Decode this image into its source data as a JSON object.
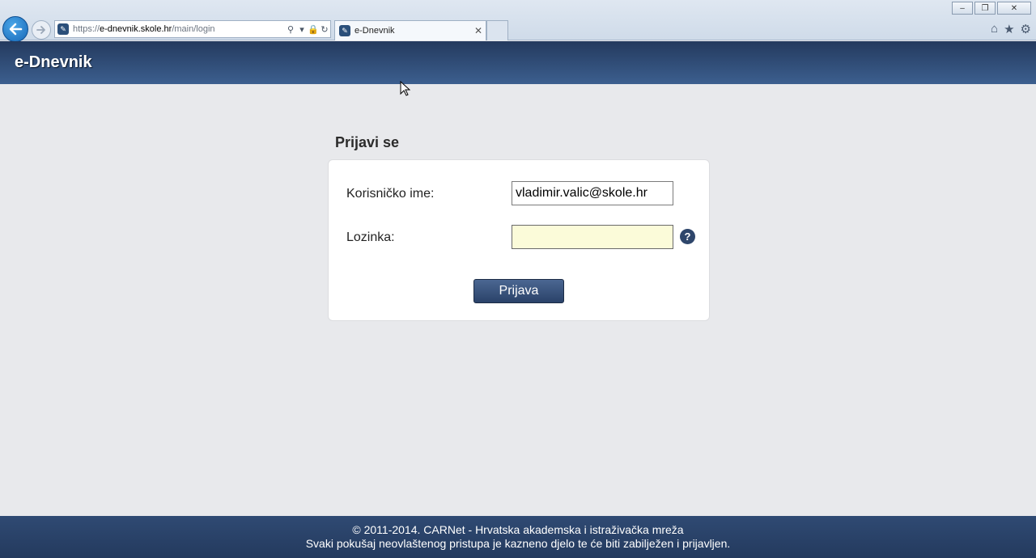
{
  "browser": {
    "address": {
      "proto": "https://",
      "host": "e-dnevnik.skole.hr",
      "path": "/main/login"
    },
    "tab_title": "e-Dnevnik",
    "window_buttons": [
      "‒",
      "❐",
      "✕"
    ]
  },
  "app": {
    "title": "e-Dnevnik"
  },
  "login": {
    "heading": "Prijavi se",
    "username_label": "Korisničko ime:",
    "username_value": "vladimir.valic@skole.hr",
    "password_label": "Lozinka:",
    "password_value": "",
    "help_symbol": "?",
    "submit_label": "Prijava"
  },
  "footer": {
    "line1": "© 2011-2014. CARNet - Hrvatska akademska i istraživačka mreža",
    "line2": "Svaki pokušaj neovlaštenog pristupa je kazneno djelo te će biti zabilježen i prijavljen."
  },
  "icons": {
    "back": "back-arrow-icon",
    "forward": "forward-arrow-icon",
    "site": "site-favicon-icon",
    "search": "search-icon",
    "lock": "lock-icon",
    "refresh": "refresh-icon",
    "home": "home-icon",
    "favorites": "star-icon",
    "tools": "gear-icon",
    "help": "help-icon"
  },
  "colors": {
    "header_bg": "#2f4a73",
    "page_bg": "#e8e9ec",
    "password_bg": "#fbfbd9",
    "button_bg": "#2a4269"
  }
}
